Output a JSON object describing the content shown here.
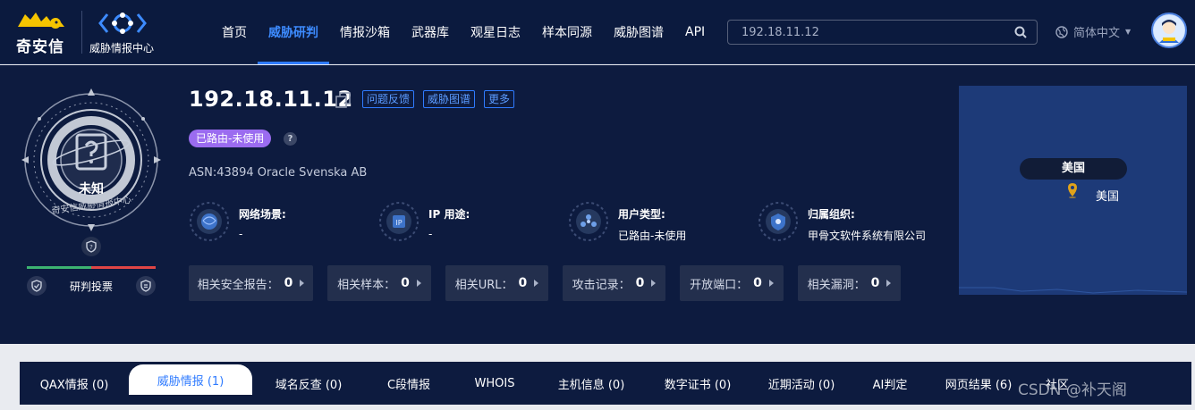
{
  "brand": {
    "name": "奇安信",
    "sub_name": "威胁情报中心"
  },
  "nav": [
    {
      "label": "首页"
    },
    {
      "label": "威胁研判",
      "active": true
    },
    {
      "label": "情报沙箱"
    },
    {
      "label": "武器库"
    },
    {
      "label": "观星日志"
    },
    {
      "label": "样本同源"
    },
    {
      "label": "威胁图谱"
    },
    {
      "label": "API"
    }
  ],
  "search": {
    "value": "192.18.11.12"
  },
  "lang": {
    "label": "简体中文"
  },
  "verdict": {
    "badge_label": "未知",
    "ring_text": "奇安信威胁情报中心",
    "vote_label": "研判投票",
    "vote_good_share": 0.5
  },
  "ip": {
    "address": "192.18.11.12",
    "actions": [
      "问题反馈",
      "威胁图谱",
      "更多"
    ],
    "route_tag": "已路由-未使用",
    "help": "?",
    "asn": "ASN:43894 Oracle Svenska AB"
  },
  "attributes": [
    {
      "label": "网络场景:",
      "value": "-",
      "icon": "globe-icon"
    },
    {
      "label": "IP 用途:",
      "value": "-",
      "icon": "ip-usage-icon"
    },
    {
      "label": "用户类型:",
      "value": "已路由-未使用",
      "icon": "user-type-icon"
    },
    {
      "label": "归属组织:",
      "value": "甲骨文软件系统有限公司",
      "icon": "organization-icon"
    }
  ],
  "stats": [
    {
      "label": "相关安全报告：",
      "count": "0"
    },
    {
      "label": "相关样本：",
      "count": "0"
    },
    {
      "label": "相关URL：",
      "count": "0"
    },
    {
      "label": "攻击记录：",
      "count": "0"
    },
    {
      "label": "开放端口：",
      "count": "0"
    },
    {
      "label": "相关漏洞：",
      "count": "0"
    }
  ],
  "map": {
    "tooltip": "美国",
    "label": "美国",
    "water_color": "#1d3a78"
  },
  "tabs": [
    {
      "label": "QAX情报 (0)"
    },
    {
      "label": "威胁情报 (1)",
      "active": true
    },
    {
      "label": "域名反查 (0)"
    },
    {
      "label": "C段情报"
    },
    {
      "label": "WHOIS"
    },
    {
      "label": "主机信息 (0)"
    },
    {
      "label": "数字证书 (0)"
    },
    {
      "label": "近期活动 (0)"
    },
    {
      "label": "AI判定"
    },
    {
      "label": "网页结果 (6)"
    },
    {
      "label": "社区"
    }
  ],
  "watermark": "CSDN @补天阁",
  "colors": {
    "nav_bg": "#0b1a3e",
    "panel_bg": "#0d1b3f",
    "accent": "#2f7bff",
    "tag_purple": "#9b6cf0"
  }
}
